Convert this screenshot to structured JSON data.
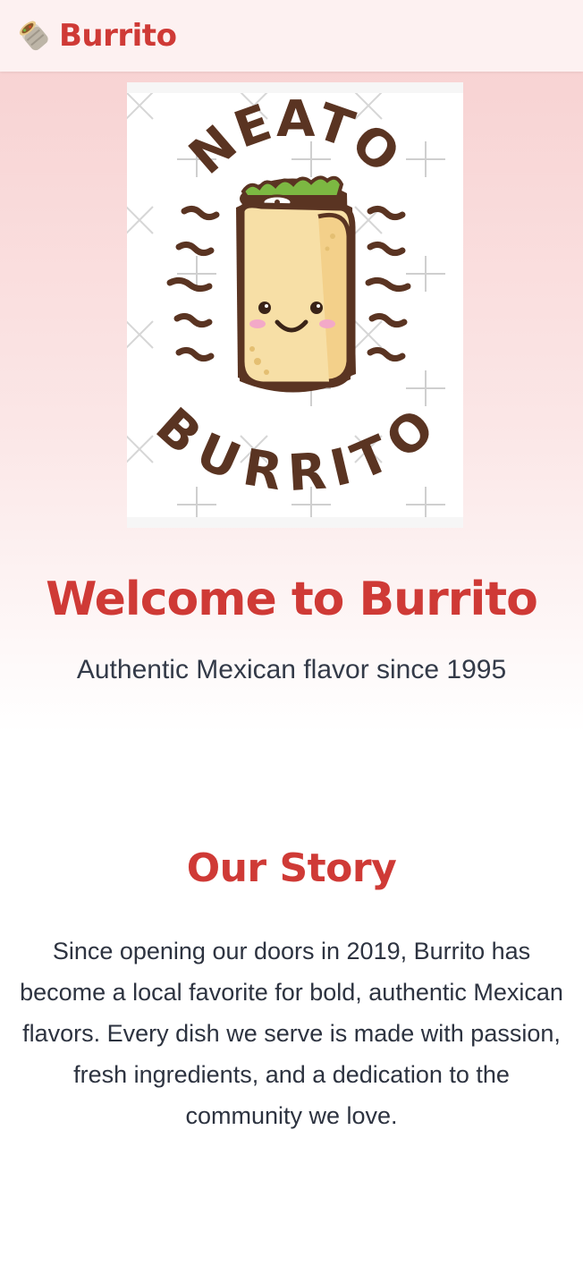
{
  "header": {
    "brand": "Burrito",
    "logo_icon": "burrito-emoji-icon"
  },
  "hero": {
    "image": {
      "icon": "neato-burrito-illustration",
      "top_text": "NEATO",
      "bottom_text": "BURRITO"
    },
    "title": "Welcome to Burrito",
    "subtitle": "Authentic Mexican flavor since 1995"
  },
  "story": {
    "title": "Our Story",
    "body": "Since opening our doors in 2019, Burrito has become a local favorite for bold, authentic Mexican flavors. Every dish we serve is made with passion, fresh ingredients, and a dedication to the community we love."
  },
  "colors": {
    "accent": "#cf3a36",
    "header_bg": "#fdf1f1",
    "hero_gradient_top": "#f8d3d3",
    "text": "#2d3340",
    "illustration_brown": "#5a3422",
    "tortilla": "#f7dfa6"
  }
}
